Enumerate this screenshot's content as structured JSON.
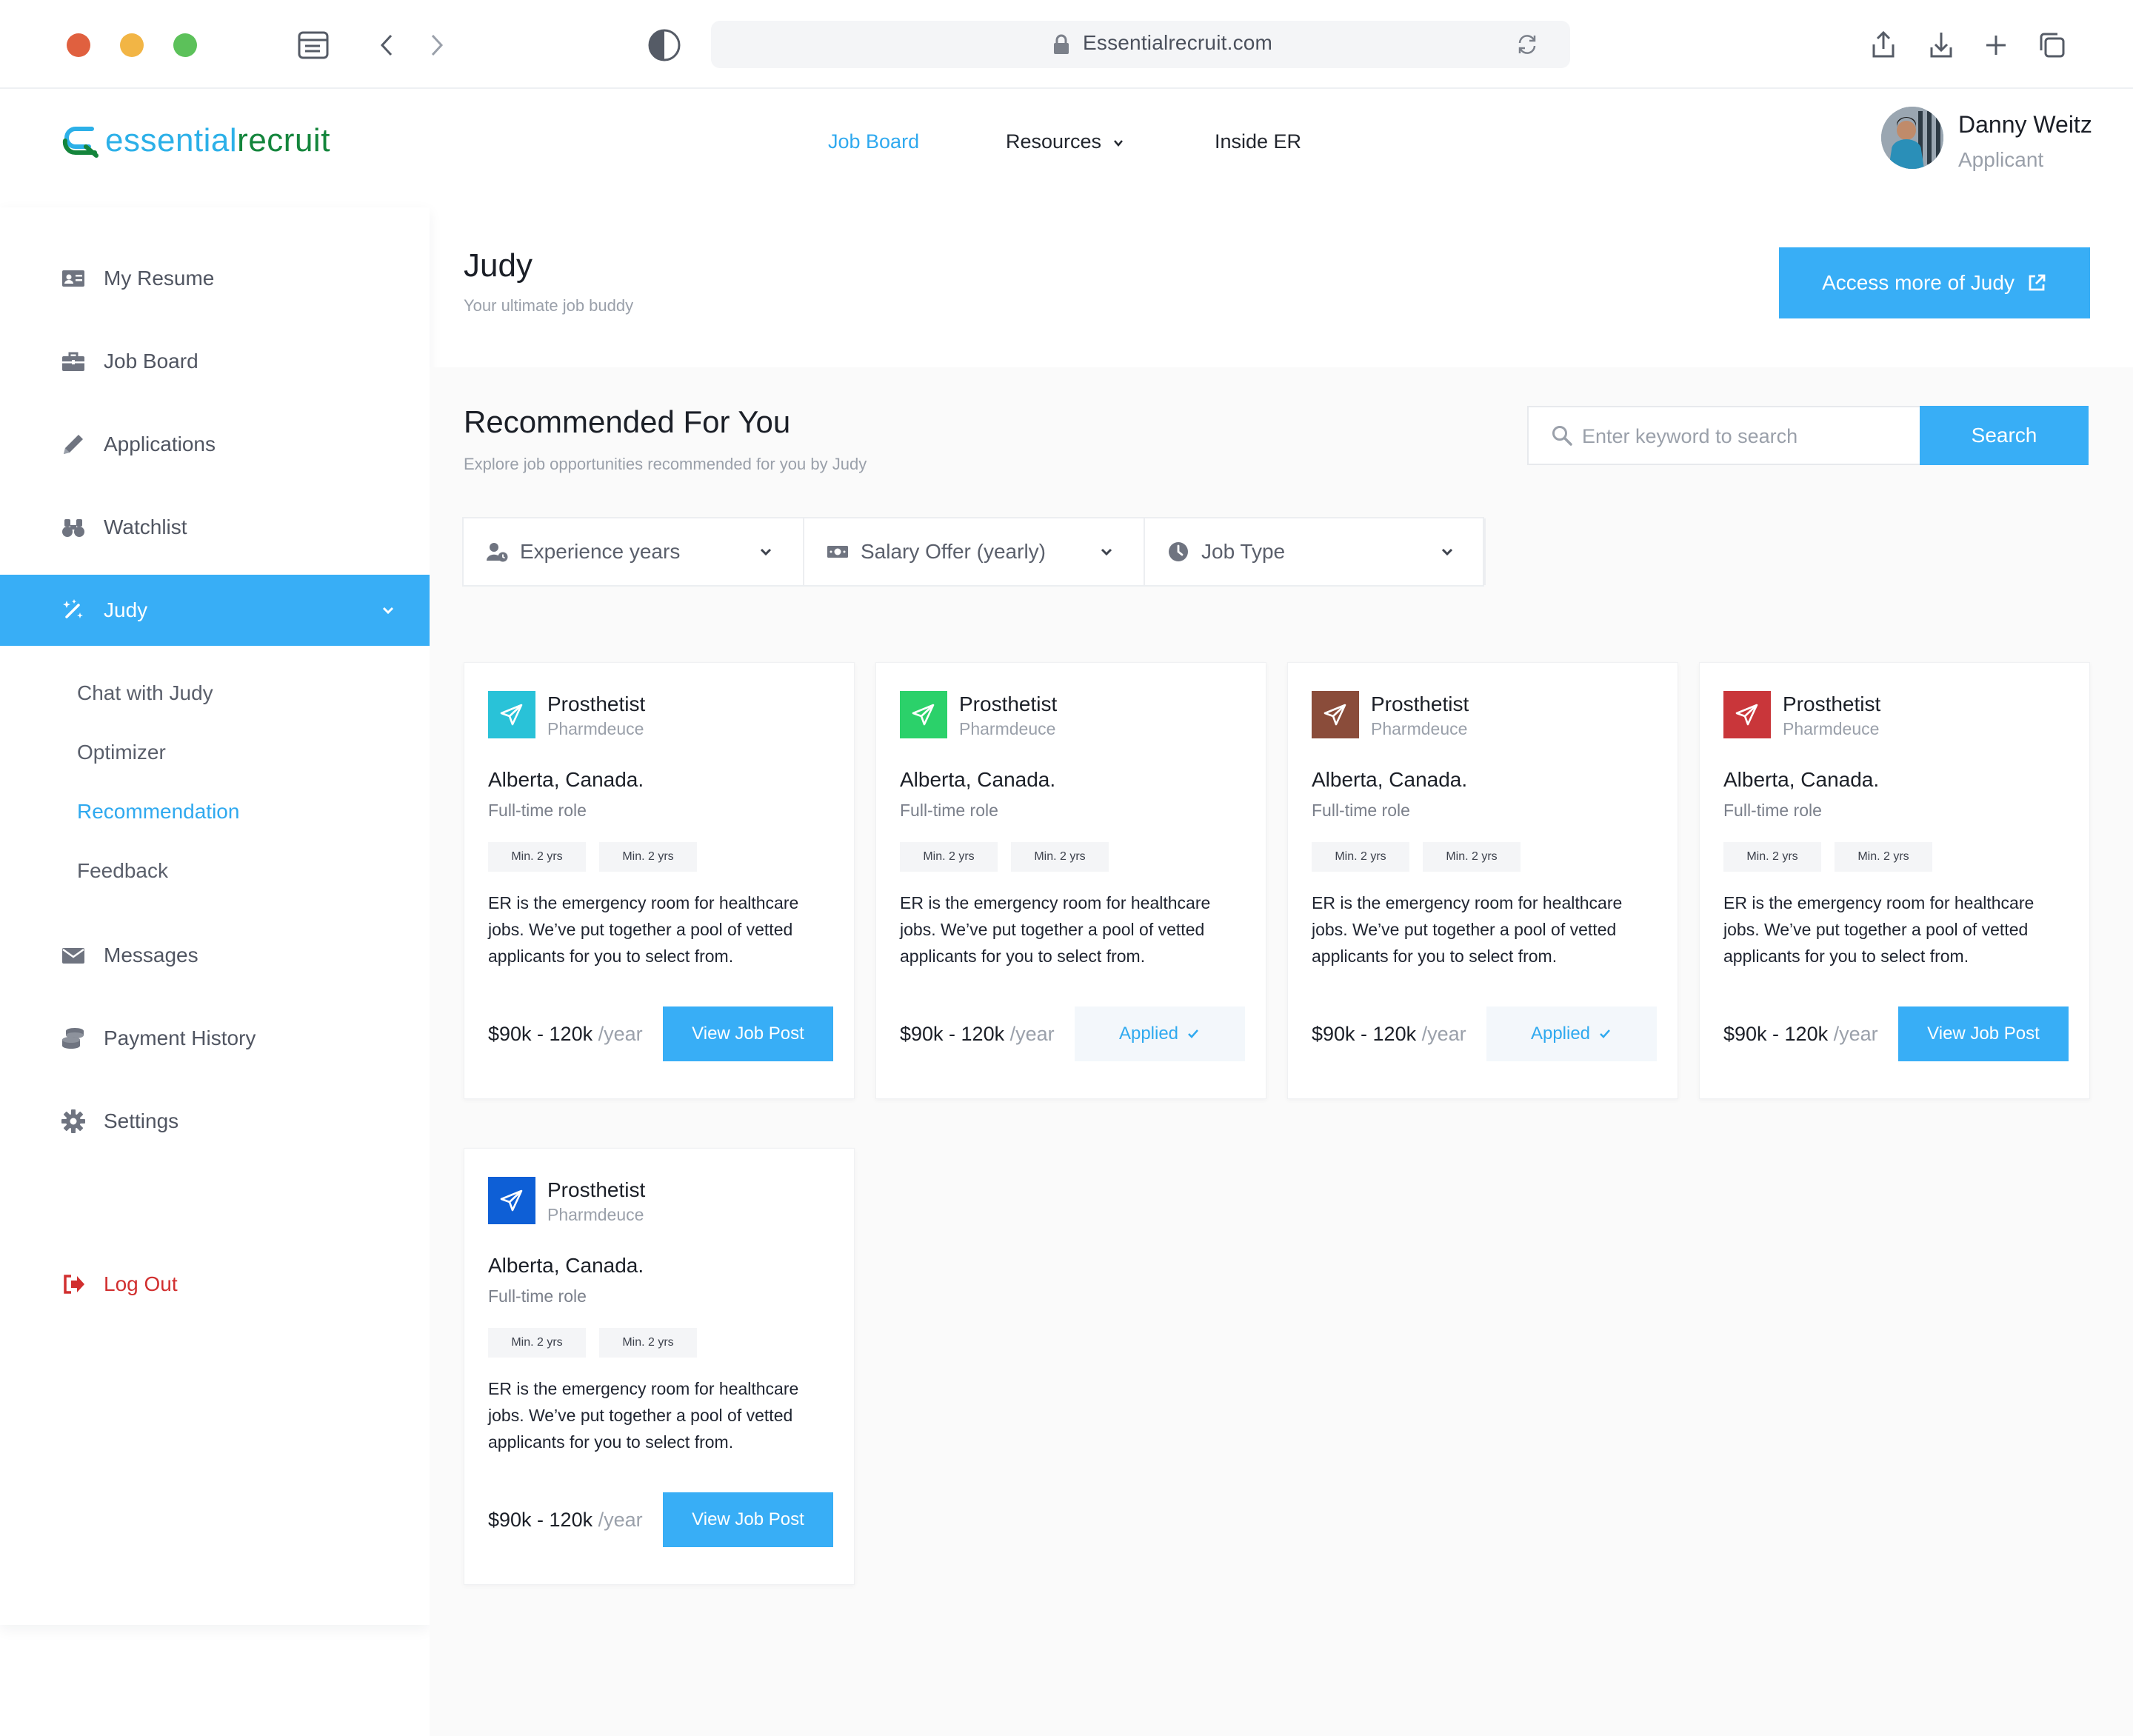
{
  "browser": {
    "url": "Essentialrecruit.com"
  },
  "brand": {
    "part1": "essential",
    "part2": "recruit",
    "colors": {
      "blue": "#2cb0e8",
      "green": "#14853c"
    }
  },
  "topnav": {
    "items": [
      {
        "label": "Job Board",
        "active": true
      },
      {
        "label": "Resources",
        "active": false,
        "dropdown": true
      },
      {
        "label": "Inside ER",
        "active": false
      }
    ]
  },
  "user": {
    "name": "Danny Weitz",
    "role": "Applicant"
  },
  "sidebar": {
    "items": [
      {
        "label": "My Resume",
        "icon": "id-card-icon"
      },
      {
        "label": "Job Board",
        "icon": "briefcase-icon"
      },
      {
        "label": "Applications",
        "icon": "pencil-icon"
      },
      {
        "label": "Watchlist",
        "icon": "binoculars-icon"
      },
      {
        "label": "Judy",
        "icon": "magic-wand-icon",
        "active": true,
        "expanded": true
      },
      {
        "label": "Messages",
        "icon": "envelope-icon"
      },
      {
        "label": "Payment History",
        "icon": "coins-icon"
      },
      {
        "label": "Settings",
        "icon": "gear-icon"
      }
    ],
    "judy_sub": [
      {
        "label": "Chat with Judy"
      },
      {
        "label": "Optimizer"
      },
      {
        "label": "Recommendation",
        "active": true
      },
      {
        "label": "Feedback"
      }
    ],
    "logout": "Log Out"
  },
  "page": {
    "title": "Judy",
    "subtitle": "Your ultimate job buddy",
    "access_button": "Access more of Judy"
  },
  "recommended": {
    "title": "Recommended For You",
    "subtitle": "Explore job opportunities recommended for you by Judy",
    "search_placeholder": "Enter keyword to search",
    "search_button": "Search",
    "filters": [
      {
        "label": "Experience years",
        "icon": "user-clock-icon"
      },
      {
        "label": "Salary Offer (yearly)",
        "icon": "money-bill-icon"
      },
      {
        "label": "Job Type",
        "icon": "clock-icon"
      }
    ]
  },
  "jobs": [
    {
      "title": "Prosthetist",
      "company": "Pharmdeuce",
      "location": "Alberta, Canada.",
      "type": "Full-time role",
      "tags": [
        "Min. 2 yrs",
        "Min. 2 yrs"
      ],
      "description": "ER is the emergency room for healthcare jobs. We’ve put together a pool of vetted applicants for you to select from.",
      "salary": "$90k - 120k",
      "per": "/year",
      "button": "View Job Post",
      "status": "view",
      "logo_color": "#29c2d8"
    },
    {
      "title": "Prosthetist",
      "company": "Pharmdeuce",
      "location": "Alberta, Canada.",
      "type": "Full-time role",
      "tags": [
        "Min. 2 yrs",
        "Min. 2 yrs"
      ],
      "description": "ER is the emergency room for healthcare jobs. We’ve put together a pool of vetted applicants for you to select from.",
      "salary": "$90k - 120k",
      "per": "/year",
      "button": "Applied",
      "status": "applied",
      "logo_color": "#2bd16a"
    },
    {
      "title": "Prosthetist",
      "company": "Pharmdeuce",
      "location": "Alberta, Canada.",
      "type": "Full-time role",
      "tags": [
        "Min. 2 yrs",
        "Min. 2 yrs"
      ],
      "description": "ER is the emergency room for healthcare jobs. We’ve put together a pool of vetted applicants for you to select from.",
      "salary": "$90k - 120k",
      "per": "/year",
      "button": "Applied",
      "status": "applied",
      "logo_color": "#8a4c3a"
    },
    {
      "title": "Prosthetist",
      "company": "Pharmdeuce",
      "location": "Alberta, Canada.",
      "type": "Full-time role",
      "tags": [
        "Min. 2 yrs",
        "Min. 2 yrs"
      ],
      "description": "ER is the emergency room for healthcare jobs. We’ve put together a pool of vetted applicants for you to select from.",
      "salary": "$90k - 120k",
      "per": "/year",
      "button": "View Job Post",
      "status": "view",
      "logo_color": "#c9363a"
    },
    {
      "title": "Prosthetist",
      "company": "Pharmdeuce",
      "location": "Alberta, Canada.",
      "type": "Full-time role",
      "tags": [
        "Min. 2 yrs",
        "Min. 2 yrs"
      ],
      "description": "ER is the emergency room for healthcare jobs. We’ve put together a pool of vetted applicants for you to select from.",
      "salary": "$90k - 120k",
      "per": "/year",
      "button": "View Job Post",
      "status": "view",
      "logo_color": "#0e5fd6"
    }
  ]
}
